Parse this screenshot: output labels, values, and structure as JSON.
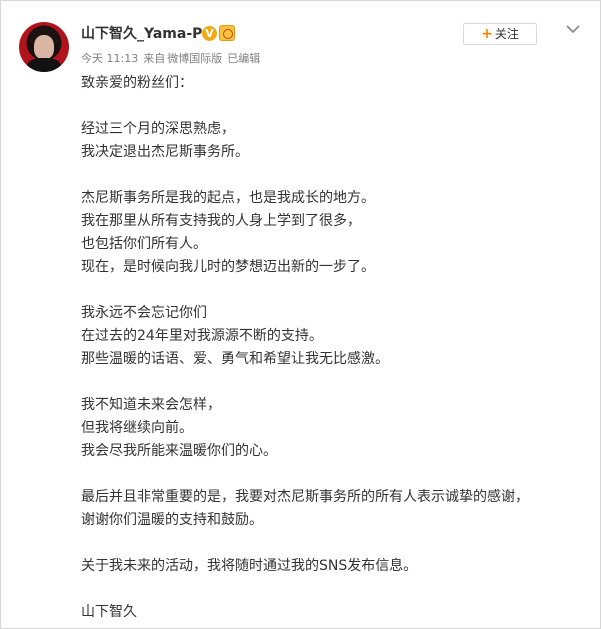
{
  "header": {
    "username": "山下智久_Yama-P",
    "verified_badge": "V",
    "time": "今天 11:13",
    "source_prefix": "来自",
    "source": "微博国际版",
    "edited": "已编辑",
    "follow_label": "关注",
    "follow_icon": "plus-icon",
    "menu_icon": "chevron-down-icon"
  },
  "post": {
    "greeting": "致亲爱的粉丝们：",
    "p1": [
      "经过三个月的深思熟虑，",
      "我决定退出杰尼斯事务所。"
    ],
    "p2": [
      "杰尼斯事务所是我的起点，也是我成长的地方。",
      "我在那里从所有支持我的人身上学到了很多，",
      "也包括你们所有人。",
      "现在，是时候向我儿时的梦想迈出新的一步了。"
    ],
    "p3": [
      "我永远不会忘记你们",
      "在过去的24年里对我源源不断的支持。",
      "那些温暖的话语、爱、勇气和希望让我无比感激。"
    ],
    "p4": [
      "我不知道未来会怎样，",
      "但我将继续向前。",
      "我会尽我所能来温暖你们的心。"
    ],
    "p5": [
      "最后并且非常重要的是，我要对杰尼斯事务所的所有人表示诚挚的感谢，",
      "谢谢你们温暖的支持和鼓励。"
    ],
    "p6": [
      "关于我未来的活动，我将随时通过我的SNS发布信息。"
    ],
    "signature": "山下智久"
  },
  "colors": {
    "accent_orange": "#ff8200",
    "verified_gold": "#f2a914",
    "text": "#333333",
    "meta": "#808080"
  }
}
